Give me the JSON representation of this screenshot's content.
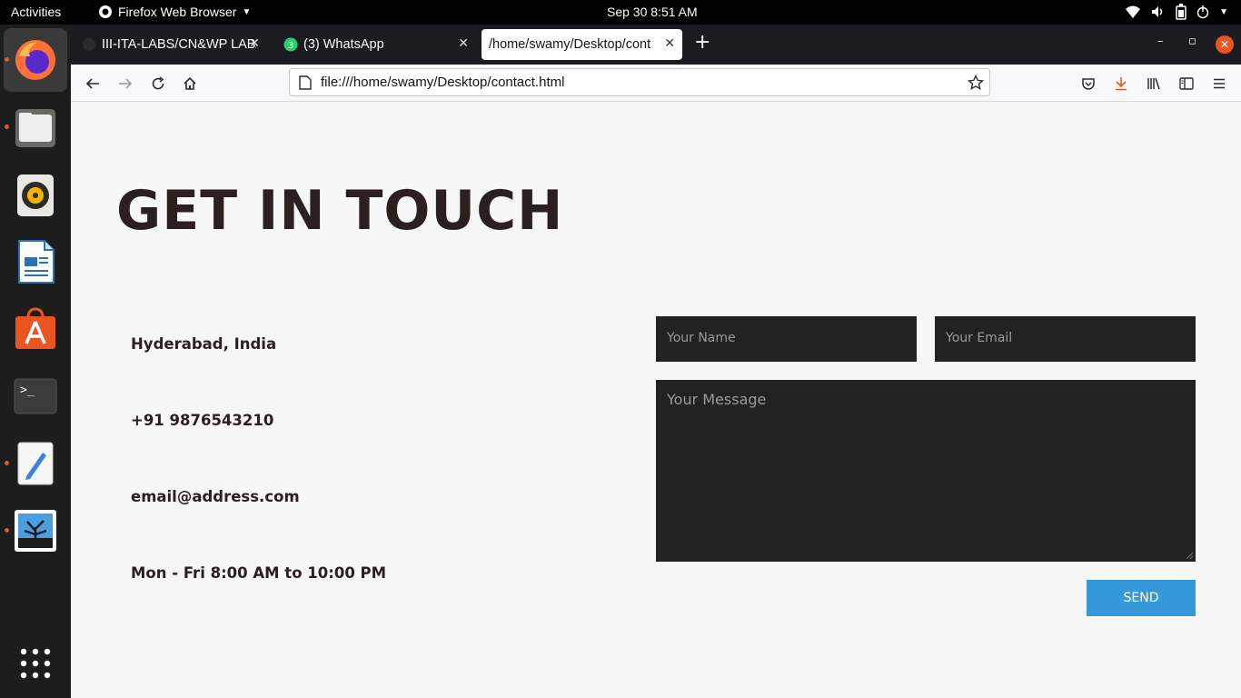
{
  "topbar": {
    "activities": "Activities",
    "app_name": "Firefox Web Browser",
    "clock": "Sep 30  8:51 AM",
    "tray_icons": [
      "wifi-icon",
      "volume-icon",
      "battery-icon",
      "power-icon"
    ]
  },
  "dock": {
    "items": [
      "firefox-icon",
      "files-icon",
      "rhythmbox-icon",
      "writer-icon",
      "software-icon",
      "terminal-icon",
      "text-editor-icon",
      "image-viewer-icon"
    ],
    "show_apps": "grid-icon"
  },
  "tabs": [
    {
      "label": "III-ITA-LABS/CN&WP LAB/",
      "active": false
    },
    {
      "label": "(3) WhatsApp",
      "active": false,
      "badge": "3"
    },
    {
      "label": "/home/swamy/Desktop/cont",
      "active": true
    }
  ],
  "navbar": {
    "url": "file:///home/swamy/Desktop/contact.html"
  },
  "page": {
    "heading": "GET IN TOUCH",
    "address": "Hyderabad, India",
    "phone": "+91 9876543210",
    "email": "email@address.com",
    "hours": "Mon - Fri 8:00 AM to 10:00 PM",
    "form": {
      "name_placeholder": "Your Name",
      "email_placeholder": "Your Email",
      "message_placeholder": "Your Message",
      "send_label": "SEND"
    }
  },
  "colors": {
    "accent": "#3498db",
    "field_bg": "#222222",
    "heading": "#2b1f1f",
    "ubuntu_orange": "#e95420"
  }
}
